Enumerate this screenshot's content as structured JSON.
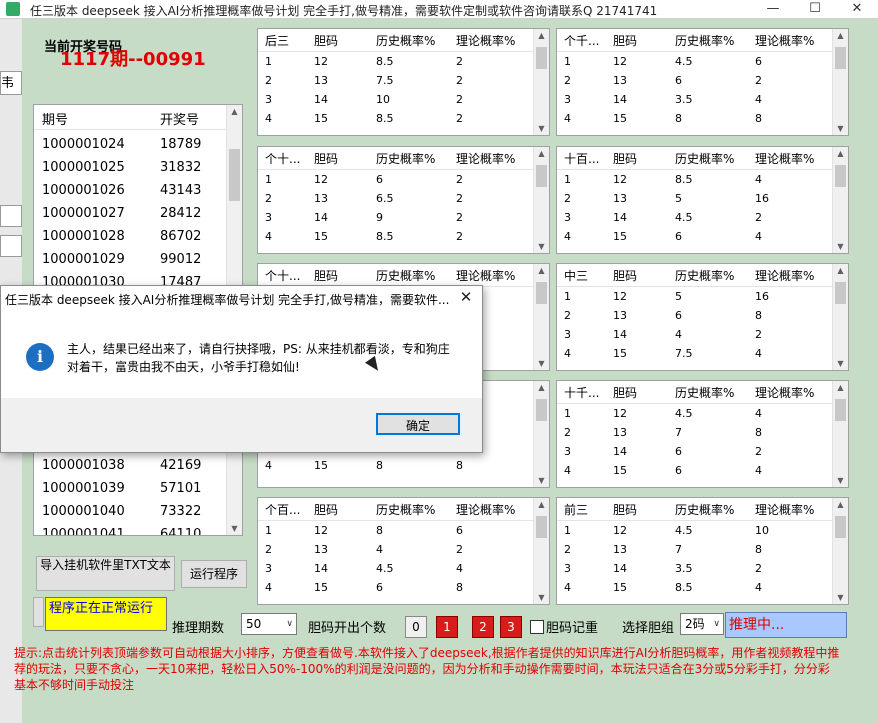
{
  "window": {
    "title": "任三版本 deepseek 接入AI分析推理概率做号计划 完全手打,做号精准，需要软件定制或软件咨询请联系Q 21741741"
  },
  "left_strip": {
    "fragment": "韦"
  },
  "current": {
    "label": "当前开奖号码",
    "issue": "1117期--00991"
  },
  "history": {
    "headers": [
      "期号",
      "开奖号"
    ],
    "rows": [
      [
        "1000001024",
        "18789"
      ],
      [
        "1000001025",
        "31832"
      ],
      [
        "1000001026",
        "43143"
      ],
      [
        "1000001027",
        "28412"
      ],
      [
        "1000001028",
        "86702"
      ],
      [
        "1000001029",
        "99012"
      ],
      [
        "1000001030",
        "17487"
      ],
      [
        "1000001038",
        "42169"
      ],
      [
        "1000001039",
        "57101"
      ],
      [
        "1000001040",
        "73322"
      ],
      [
        "1000001041",
        "64110"
      ]
    ]
  },
  "grids": [
    {
      "title": "后三",
      "rows": [
        [
          "1",
          "12",
          "8.5",
          "2"
        ],
        [
          "2",
          "13",
          "7.5",
          "2"
        ],
        [
          "3",
          "14",
          "10",
          "2"
        ],
        [
          "4",
          "15",
          "8.5",
          "2"
        ]
      ]
    },
    {
      "title": "个千...",
      "rows": [
        [
          "1",
          "12",
          "4.5",
          "6"
        ],
        [
          "2",
          "13",
          "6",
          "2"
        ],
        [
          "3",
          "14",
          "3.5",
          "4"
        ],
        [
          "4",
          "15",
          "8",
          "8"
        ]
      ]
    },
    {
      "title": "个十...",
      "rows": [
        [
          "1",
          "12",
          "6",
          "2"
        ],
        [
          "2",
          "13",
          "6.5",
          "2"
        ],
        [
          "3",
          "14",
          "9",
          "2"
        ],
        [
          "4",
          "15",
          "8.5",
          "2"
        ]
      ]
    },
    {
      "title": "十百...",
      "rows": [
        [
          "1",
          "12",
          "8.5",
          "4"
        ],
        [
          "2",
          "13",
          "5",
          "16"
        ],
        [
          "3",
          "14",
          "4.5",
          "2"
        ],
        [
          "4",
          "15",
          "6",
          "4"
        ]
      ]
    },
    {
      "title": "个十...",
      "rows": []
    },
    {
      "title": "中三",
      "rows": [
        [
          "1",
          "12",
          "5",
          "16"
        ],
        [
          "2",
          "13",
          "6",
          "8"
        ],
        [
          "3",
          "14",
          "4",
          "2"
        ],
        [
          "4",
          "15",
          "7.5",
          "4"
        ]
      ]
    },
    {
      "title": "",
      "rows": [
        [
          "3",
          "14",
          "8",
          "12"
        ],
        [
          "4",
          "15",
          "8",
          "8"
        ]
      ]
    },
    {
      "title": "十千...",
      "rows": [
        [
          "1",
          "12",
          "4.5",
          "4"
        ],
        [
          "2",
          "13",
          "7",
          "8"
        ],
        [
          "3",
          "14",
          "6",
          "2"
        ],
        [
          "4",
          "15",
          "6",
          "4"
        ]
      ]
    },
    {
      "title": "个百...",
      "rows": [
        [
          "1",
          "12",
          "8",
          "6"
        ],
        [
          "2",
          "13",
          "4",
          "2"
        ],
        [
          "3",
          "14",
          "4.5",
          "4"
        ],
        [
          "4",
          "15",
          "6",
          "8"
        ]
      ]
    },
    {
      "title": "前三",
      "rows": [
        [
          "1",
          "12",
          "4.5",
          "10"
        ],
        [
          "2",
          "13",
          "7",
          "8"
        ],
        [
          "3",
          "14",
          "3.5",
          "2"
        ],
        [
          "4",
          "15",
          "8.5",
          "4"
        ]
      ]
    }
  ],
  "grid_headers": [
    "胆码",
    "历史概率%",
    "理论概率%"
  ],
  "buttons": {
    "import": "导入挂机软件里TXT文本",
    "run": "运行程序"
  },
  "status": "程序正在正常运行",
  "controls": {
    "periods_label": "推理期数",
    "periods_value": "50",
    "count_label": "胆码开出个数",
    "counts": [
      "0",
      "1",
      "2",
      "3"
    ],
    "record_label": "胆码记重",
    "select_label": "选择胆组",
    "select_value": "2码",
    "inferring": "推理中..."
  },
  "note": "提示:点击统计列表顶端参数可自动根据大小排序，方便查看做号.本软件接入了deepseek,根据作者提供的知识库进行AI分析胆码概率，用作者视频教程中推荐的玩法，只要不贪心，一天10来把，轻松日入50%-100%的利润是没问题的，因为分析和手动操作需要时间，本玩法只适合在3分或5分彩手打，分分彩基本不够时间手动投注",
  "dialog": {
    "title": "任三版本 deepseek 接入AI分析推理概率做号计划 完全手打,做号精准，需要软件...",
    "message": "主人，结果已经出来了，请自行抉择哦，PS: 从来挂机都看淡，专和狗庄对着干，富贵由我不由天，小爷手打稳如仙!",
    "ok": "确定"
  },
  "colors": {
    "accent_red": "#e00000",
    "status_yellow": "#ffff00",
    "bg_green": "#c7dcc7",
    "infer_blue": "#a8c8ff"
  }
}
